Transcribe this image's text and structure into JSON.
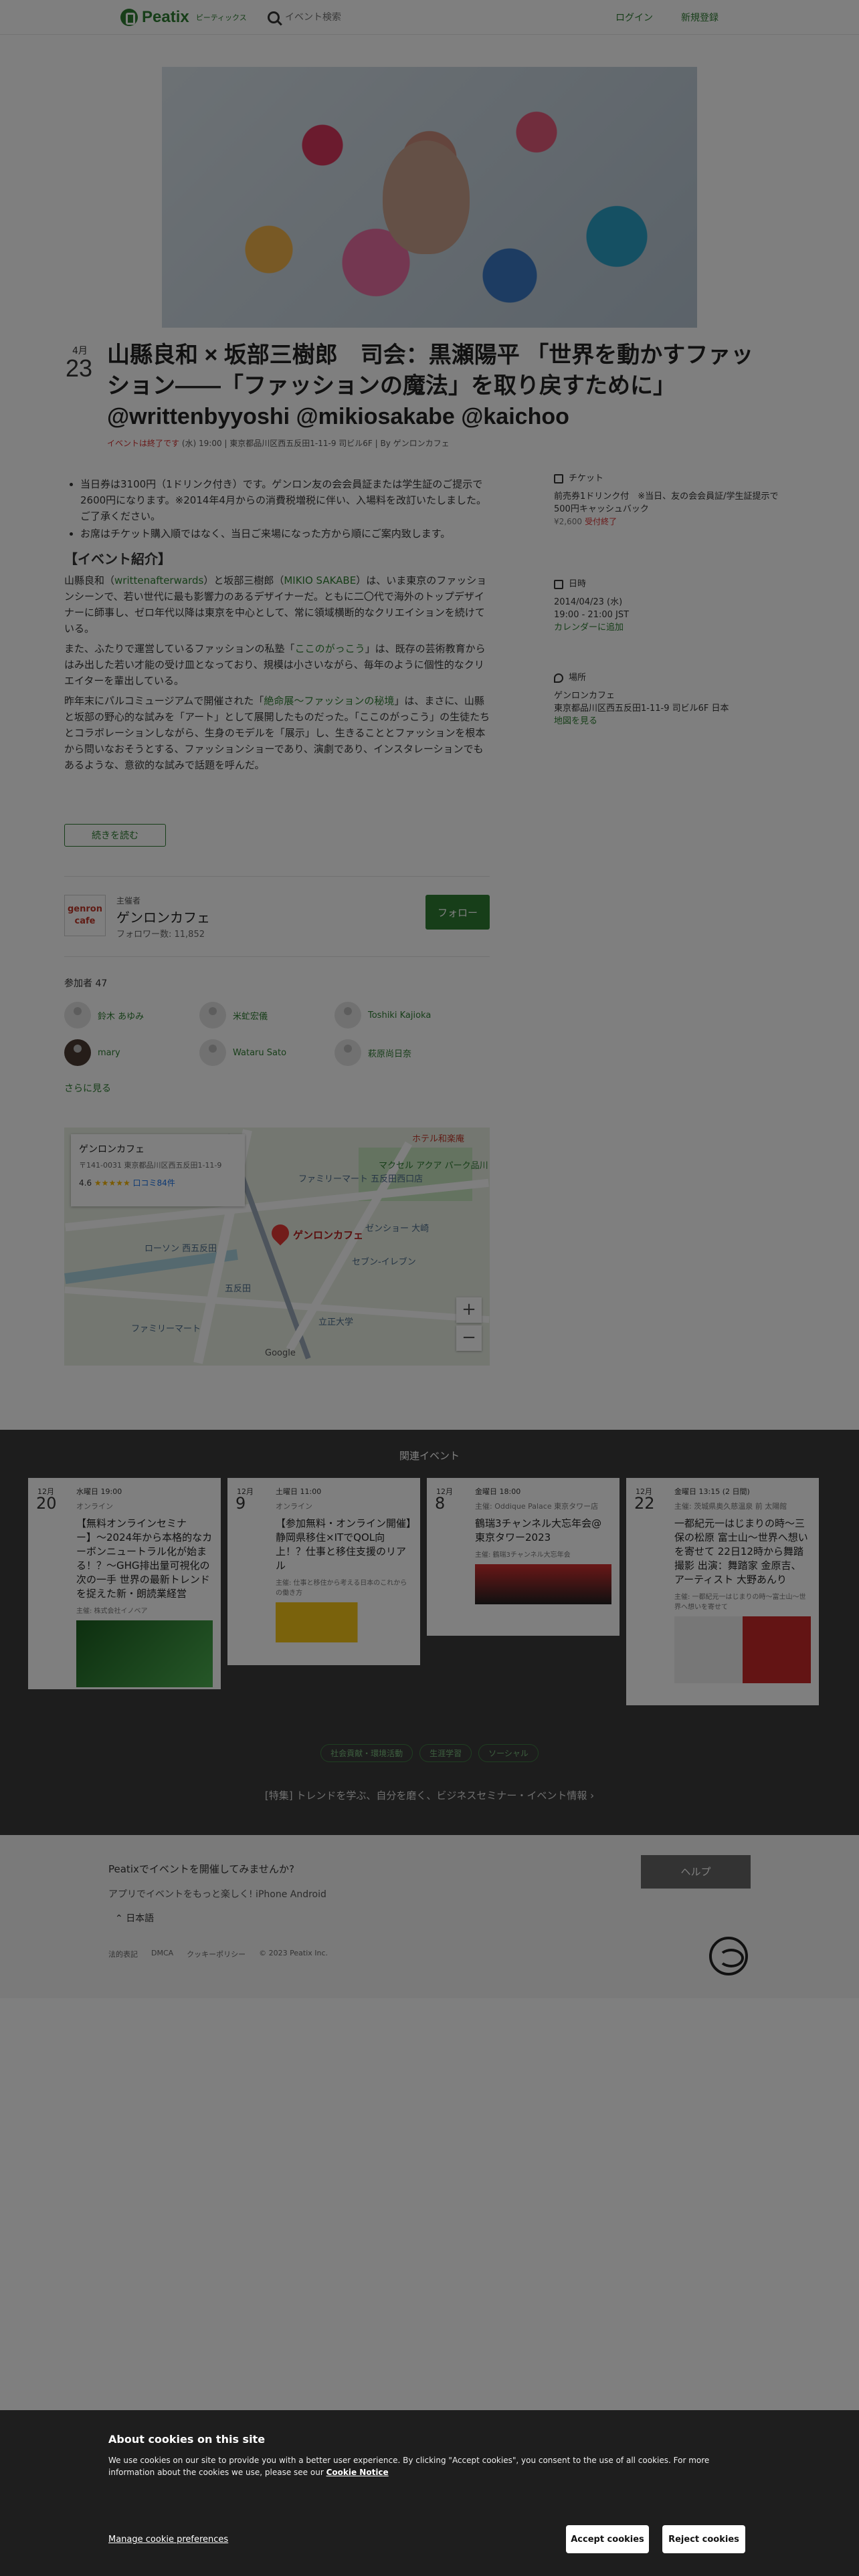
{
  "header": {
    "logo_text": "Peatix",
    "logo_sub": "ピーティックス",
    "search_placeholder": "イベント検索",
    "login": "ログイン",
    "signup": "新規登録"
  },
  "event": {
    "month": "4月",
    "day": "23",
    "title": "山縣良和 × 坂部三樹郎　司会：黒瀬陽平 「世界を動かすファッション——「ファッションの魔法」を取り戻すために」 @writtenbyyoshi @mikiosakabe @kaichoo",
    "status": "イベントは終了です",
    "meta": "(水) 19:00 | 東京都品川区西五反田1-11-9 司ビル6F | By ゲンロンカフェ"
  },
  "description": {
    "bullets": [
      "当日券は3100円（1ドリンク付き）です。ゲンロン友の会会員証または学生証のご提示で2600円になります。※2014年4月からの消費税増税に伴い、入場料を改訂いたしました。ご了承ください。",
      "お席はチケット購入順ではなく、当日ご来場になった方から順にご案内致します。"
    ],
    "heading": "【イベント紹介】",
    "p1_a": "山縣良和（",
    "p1_link1": "writtenafterwards",
    "p1_b": "）と坂部三樹郎（",
    "p1_link2": "MIKIO SAKABE",
    "p1_c": "）は、いま東京のファッションシーンで、若い世代に最も影響力のあるデザイナーだ。ともに二〇代で海外のトップデザイナーに師事し、ゼロ年代以降は東京を中心として、常に領域横断的なクリエイションを続けている。",
    "p2_a": "また、ふたりで運営しているファッションの私塾「",
    "p2_link": "ここのがっこう",
    "p2_b": "」は、既存の芸術教育からはみ出した若い才能の受け皿となっており、規模は小さいながら、毎年のように個性的なクリエイターを輩出している。",
    "p3_a": "昨年末にパルコミュージアムで開催された「",
    "p3_link": "絶命展〜ファッションの秘境",
    "p3_b": "」は、まさに、山縣と坂部の野心的な試みを「アート」として展開したものだった。「ここのがっこう」の生徒たちとコラボレーションしながら、生身のモデルを「展示」し、生きることとファッションを根本から問いなおそうとする、ファッションショーであり、演劇であり、インスタレーションでもあるような、意欲的な試みで話題を呼んだ。",
    "read_more": "続きを読む"
  },
  "side": {
    "ticket_head": "チケット",
    "ticket_name": "前売券1ドリンク付　※当日、友の会会員証/学生証提示で500円キャッシュバック",
    "ticket_price": "¥2,600",
    "ticket_status": "受付終了",
    "date_head": "日時",
    "date_line1": "2014/04/23 (水)",
    "date_line2": "19:00 - 21:00 JST",
    "date_link": "カレンダーに追加",
    "place_head": "場所",
    "place_name": "ゲンロンカフェ",
    "place_addr": "東京都品川区西五反田1-11-9 司ビル6F 日本",
    "place_link": "地図を見る"
  },
  "organizer": {
    "logo_line1": "genron",
    "logo_line2": "cafe",
    "label": "主催者",
    "name": "ゲンロンカフェ",
    "followers": "フォロワー数: 11,852",
    "follow": "フォロー"
  },
  "attendees": {
    "title": "参加者 47",
    "list": [
      "鈴木 あゆみ",
      "米虻宏儀",
      "Toshiki Kajioka",
      "mary",
      "Wataru Sato",
      "萩原尚日奈"
    ],
    "see_more": "さらに見る"
  },
  "map": {
    "card_title": "ゲンロンカフェ",
    "card_addr": "〒141-0031 東京都品川区西五反田1-11-9",
    "card_rating": "4.6",
    "card_stars": "★★★★★",
    "card_reviews": "口コミ84件",
    "pin_label": "ゲンロンカフェ",
    "zoom_in": "+",
    "zoom_out": "−",
    "labels": [
      "ホテル和楽庵",
      "マクセル アクア パーク品川",
      "ファミリーマート 五反田西口店",
      "ローソン 西五反田",
      "ゼンショー 大崎",
      "セブン-イレブン",
      "ファミリーマート",
      "五反田",
      "立正大学",
      "Google"
    ]
  },
  "related": {
    "title": "関連イベント",
    "cards": [
      {
        "month": "12月",
        "day": "20",
        "time": "水曜日 19:00",
        "place": "オンライン",
        "title": "【無料オンラインセミナー】〜2024年から本格的なカーボンニュートラル化が始まる！？〜GHG排出量可視化の次の一手 世界の最新トレンドを捉えた新・朗読業経営",
        "org": "主催: 株式会社イノベア",
        "accent": "#4caf50"
      },
      {
        "month": "12月",
        "day": "9",
        "time": "土曜日 11:00",
        "place": "オンライン",
        "title": "【参加無料・オンライン開催】静岡県移住×ITでQOL向上！？仕事と移住支援のリアル",
        "org": "主催: 仕事と移住から考える日本のこれからの働き方",
        "accent": "#f5c518"
      },
      {
        "month": "12月",
        "day": "8",
        "time": "金曜日 18:00",
        "place": "主催: Oddique Palace 東京タワー店",
        "title": "鶴瑞3チャンネル大忘年会@東京タワー2023",
        "org": "主催: 鶴瑞3チャンネル大忘年会",
        "accent": "#d32f2f"
      },
      {
        "month": "12月",
        "day": "22",
        "time": "金曜日 13:15 (2 日間)",
        "place": "主催: 茨城県奥久慈温泉 前 太陽館",
        "title": "一都紀元一はじまりの時〜三保の松原 富士山〜世界へ想いを寄せて 22日12時から舞踏撮影 出演：舞踏家 金原吉、アーティスト 大野あんり",
        "org": "主催: 一都紀元一はじまりの時〜富士山〜世界へ想いを寄せて",
        "accent": "#c62828"
      }
    ],
    "tags": [
      "社会貢献・環境活動",
      "生涯学習",
      "ソーシャル"
    ],
    "feature": "[特集] トレンドを学ぶ、自分を磨く、ビジネスセミナー・イベント情報"
  },
  "footer": {
    "host": "Peatixでイベントを開催してみませんか?",
    "app": "アプリでイベントをもっと楽しく! iPhone Android",
    "lang": "日本語",
    "links": [
      "法的表記",
      "DMCA",
      "クッキーポリシー",
      "© 2023 Peatix Inc."
    ],
    "help": "ヘルプ"
  },
  "cookie": {
    "title": "About cookies on this site",
    "text": "We use cookies on our site to provide you with a better user experience. By clicking \"Accept cookies\", you consent to the use of all cookies. For more information about the cookies we use, please see our",
    "notice": "Cookie Notice",
    "manage": "Manage cookie preferences",
    "accept": "Accept cookies",
    "reject": "Reject cookies"
  }
}
